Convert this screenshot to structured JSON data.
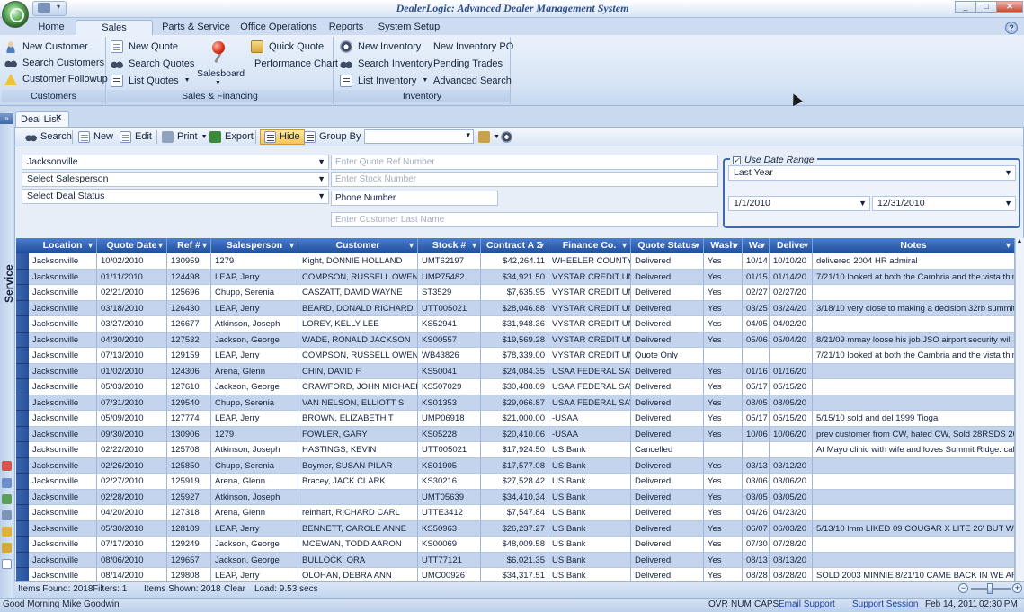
{
  "window": {
    "title": "DealerLogic: Advanced Dealer Management System"
  },
  "ribbon": {
    "tabs": [
      {
        "label": "Home",
        "active": false
      },
      {
        "label": "Sales Operations",
        "active": true
      },
      {
        "label": "Parts & Service",
        "active": false
      },
      {
        "label": "Office Operations",
        "active": false
      },
      {
        "label": "Reports",
        "active": false
      },
      {
        "label": "System Setup",
        "active": false
      }
    ],
    "customers": {
      "label": "Customers",
      "items": [
        "New Customer",
        "Search Customers",
        "Customer Followup"
      ]
    },
    "sales": {
      "label": "Sales & Financing",
      "new_quote": "New Quote",
      "search_quotes": "Search Quotes",
      "list_quotes": "List Quotes",
      "salesboard": "Salesboard",
      "quick_quote": "Quick Quote",
      "performance_chart": "Performance Chart"
    },
    "inventory": {
      "label": "Inventory",
      "new_inventory": "New Inventory",
      "search_inventory": "Search Inventory",
      "list_inventory": "List Inventory",
      "new_po": "New Inventory PO",
      "pending_trades": "Pending Trades",
      "advanced_search": "Advanced Search"
    }
  },
  "sidebar": {
    "label": "Service"
  },
  "document_tab": {
    "label": "Deal List"
  },
  "toolbar": {
    "search": "Search",
    "new": "New",
    "edit": "Edit",
    "print": "Print",
    "export": "Export",
    "hide": "Hide",
    "group_by": "Group By"
  },
  "filters": {
    "location": "Jacksonville",
    "salesperson": "Select Salesperson",
    "deal_status": "Select Deal Status",
    "quote_ref_placeholder": "Enter Quote Ref Number",
    "stock_placeholder": "Enter Stock Number",
    "phone_value": "Phone Number",
    "last_name_placeholder": "Enter Customer Last Name",
    "date_range": {
      "label": "Use Date Range",
      "checked": true,
      "preset": "Last Year",
      "from": "1/1/2010",
      "to": "12/31/2010"
    }
  },
  "grid": {
    "columns": [
      "Location",
      "Quote Date",
      "Ref #",
      "Salesperson",
      "Customer",
      "Stock #",
      "Contract A Σ",
      "Finance Co.",
      "Quote Status",
      "Wash",
      "Wa",
      "Delive",
      "Notes"
    ],
    "rows": [
      [
        "Jacksonville",
        "10/02/2010",
        "130959",
        "1279",
        "Kight, DONNIE HOLLAND",
        "UMT62197",
        "$42,264.11",
        "WHEELER COUNTY S",
        "Delivered",
        "Yes",
        "10/14",
        "10/10/20",
        "delivered 2004 HR admiral"
      ],
      [
        "Jacksonville",
        "01/11/2010",
        "124498",
        "LEAP, Jerry",
        "COMPSON, RUSSELL OWEN",
        "UMP75482",
        "$34,921.50",
        "VYSTAR CREDIT UNI",
        "Delivered",
        "Yes",
        "01/15",
        "01/14/20",
        "7/21/10 looked at both the Cambria and the vista  think"
      ],
      [
        "Jacksonville",
        "02/21/2010",
        "125696",
        "Chupp, Serenia",
        "CASZATT, DAVID WAYNE",
        "ST3529",
        "$7,635.95",
        "VYSTAR CREDIT UNI",
        "Delivered",
        "Yes",
        "02/27",
        "02/27/20",
        ""
      ],
      [
        "Jacksonville",
        "03/18/2010",
        "126430",
        "LEAP, Jerry",
        "BEARD, DONALD RICHARD",
        "UTT005021",
        "$28,046.88",
        "VYSTAR CREDIT UNI",
        "Delivered",
        "Yes",
        "03/25",
        "03/24/20",
        "3/18/10 very close to making a decision 32rb summit ri"
      ],
      [
        "Jacksonville",
        "03/27/2010",
        "126677",
        "Atkinson, Joseph",
        "LOREY, KELLY LEE",
        "KS52941",
        "$31,948.36",
        "VYSTAR CREDIT UNI",
        "Delivered",
        "Yes",
        "04/05",
        "04/02/20",
        ""
      ],
      [
        "Jacksonville",
        "04/30/2010",
        "127532",
        "Jackson, George",
        "WADE, RONALD JACKSON",
        "KS00557",
        "$19,569.28",
        "VYSTAR CREDIT UNI",
        "Delivered",
        "Yes",
        "05/06",
        "05/04/20",
        "8/21/09  mmay loose his job JSO airport security will ho"
      ],
      [
        "Jacksonville",
        "07/13/2010",
        "129159",
        "LEAP, Jerry",
        "COMPSON, RUSSELL OWEN",
        "WB43826",
        "$78,339.00",
        "VYSTAR CREDIT UNI",
        "Quote Only",
        "",
        "",
        "",
        "7/21/10 looked at both the Cambria and the vista  think"
      ],
      [
        "Jacksonville",
        "01/02/2010",
        "124306",
        "Arena, Glenn",
        "CHIN, DAVID F",
        "KS50041",
        "$24,084.35",
        "USAA FEDERAL SAVI",
        "Delivered",
        "Yes",
        "01/16",
        "01/16/20",
        ""
      ],
      [
        "Jacksonville",
        "05/03/2010",
        "127610",
        "Jackson, George",
        "CRAWFORD, JOHN MICHAEL",
        "KS507029",
        "$30,488.09",
        "USAA FEDERAL SAVI",
        "Delivered",
        "Yes",
        "05/17",
        "05/15/20",
        ""
      ],
      [
        "Jacksonville",
        "07/31/2010",
        "129540",
        "Chupp, Serenia",
        "VAN NELSON, ELLIOTT S",
        "KS01353",
        "$29,066.87",
        "USAA FEDERAL SAVI",
        "Delivered",
        "Yes",
        "08/05",
        "08/05/20",
        ""
      ],
      [
        "Jacksonville",
        "05/09/2010",
        "127774",
        "LEAP, Jerry",
        "BROWN, ELIZABETH T",
        "UMP06918",
        "$21,000.00",
        "-USAA",
        "Delivered",
        "Yes",
        "05/17",
        "05/15/20",
        "5/15/10 sold and del 1999 Tioga"
      ],
      [
        "Jacksonville",
        "09/30/2010",
        "130906",
        "1279",
        "FOWLER, GARY",
        "KS05228",
        "$20,410.06",
        "-USAA",
        "Delivered",
        "Yes",
        "10/06",
        "10/06/20",
        "prev customer from CW, hated CW, Sold 28RSDS 2009"
      ],
      [
        "Jacksonville",
        "02/22/2010",
        "125708",
        "Atkinson, Joseph",
        "HASTINGS, KEVIN",
        "UTT005021",
        "$17,924.50",
        "US Bank",
        "Cancelled",
        "",
        "",
        "",
        "At Mayo clinic with wife and loves Summit Ridge. called"
      ],
      [
        "Jacksonville",
        "02/26/2010",
        "125850",
        "Chupp, Serenia",
        "Boymer, SUSAN PILAR",
        "KS01905",
        "$17,577.08",
        "US Bank",
        "Delivered",
        "Yes",
        "03/13",
        "03/12/20",
        ""
      ],
      [
        "Jacksonville",
        "02/27/2010",
        "125919",
        "Arena, Glenn",
        "Bracey, JACK CLARK",
        "KS30216",
        "$27,528.42",
        "US Bank",
        "Delivered",
        "Yes",
        "03/06",
        "03/06/20",
        ""
      ],
      [
        "Jacksonville",
        "02/28/2010",
        "125927",
        "Atkinson, Joseph",
        "",
        "UMT05639",
        "$34,410.34",
        "US Bank",
        "Delivered",
        "Yes",
        "03/05",
        "03/05/20",
        ""
      ],
      [
        "Jacksonville",
        "04/20/2010",
        "127318",
        "Arena, Glenn",
        "reinhart, RICHARD CARL",
        "UTTE3412",
        "$7,547.84",
        "US Bank",
        "Delivered",
        "Yes",
        "04/26",
        "04/23/20",
        ""
      ],
      [
        "Jacksonville",
        "05/30/2010",
        "128189",
        "LEAP, Jerry",
        "BENNETT, CAROLE ANNE",
        "KS50963",
        "$26,237.27",
        "US Bank",
        "Delivered",
        "Yes",
        "06/07",
        "06/03/20",
        "5/13/10 lmm    LIKED 09 COUGAR X LITE 26' BUT WOUL"
      ],
      [
        "Jacksonville",
        "07/17/2010",
        "129249",
        "Jackson, George",
        "MCEWAN, TODD AARON",
        "KS00069",
        "$48,009.58",
        "US Bank",
        "Delivered",
        "Yes",
        "07/30",
        "07/28/20",
        ""
      ],
      [
        "Jacksonville",
        "08/06/2010",
        "129657",
        "Jackson, George",
        "BULLOCK, ORA",
        "UTT77121",
        "$6,021.35",
        "US Bank",
        "Delivered",
        "Yes",
        "08/13",
        "08/13/20",
        ""
      ],
      [
        "Jacksonville",
        "08/14/2010",
        "129808",
        "LEAP, Jerry",
        "OLOHAN, DEBRA ANN",
        "UMC00926",
        "$34,317.51",
        "US Bank",
        "Delivered",
        "Yes",
        "08/28",
        "08/28/20",
        "SOLD 2003 MINNIE   8/21/10 CAME BACK IN WE ARE C"
      ]
    ]
  },
  "grid_status": {
    "items_found": "Items Found: 2018",
    "filters": "Filters: 1",
    "items_shown": "Items Shown: 2018",
    "clear": "Clear",
    "load": "Load: 9.53 secs"
  },
  "status_bar": {
    "greeting": "Good Morning Mike Goodwin",
    "ovr": "OVR",
    "num": "NUM",
    "caps": "CAPS",
    "email_support": "Email Support",
    "support_session": "Support Session",
    "date": "Feb 14, 2011",
    "time": "02:30 PM"
  },
  "colors": {
    "header_blue": "#1f4d9b",
    "row_alt": "#c4d4ec",
    "accent_orange": "#f6c458"
  }
}
